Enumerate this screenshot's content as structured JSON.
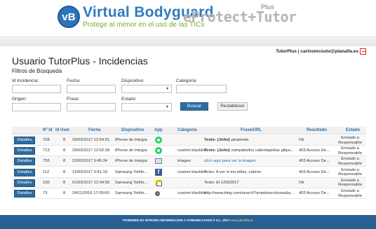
{
  "header": {
    "logo_mark": "vB",
    "brand_name": "Virtual Bodyguard",
    "brand_tagline": "Protege al menor en el uso de las TICs",
    "product_name": "eProtect+Tutor",
    "product_plus": "Plus"
  },
  "user": {
    "info": "TutorPlus | carlosmcouto@planalfa.es"
  },
  "page": {
    "title": "Usuario TutorPlus - Incidencias",
    "filters_title": "Filtros de Búsqueda"
  },
  "filters": {
    "id_label": "Id Incidencia:",
    "fecha_label": "Fecha:",
    "dispositivo_label": "Dispositivo:",
    "categoria_label": "Categoría",
    "origen_label": "Origen:",
    "frase_label": "Frase:",
    "estado_label": "Estado",
    "search_button": "Buscar",
    "reset_button": "Restablecer"
  },
  "table": {
    "headers": [
      "Nº Id",
      "Id User",
      "Fecha",
      "Dispositivo",
      "App",
      "Categoría",
      "Frase/URL",
      "Resultado",
      "Estado"
    ],
    "details_label": "Detalles",
    "rows": [
      {
        "id": "708",
        "user": "8",
        "fecha": "29/03/2017 12:54:01",
        "dispositivo": "iPhone de Integra",
        "app": "whatsapp-icon",
        "categoria": "",
        "frase_bold": "Texto: {John}",
        "frase": "pimpinela",
        "resultado": "Ok",
        "estado1": "Enviado a",
        "estado2": "Responsable"
      },
      {
        "id": "713",
        "user": "8",
        "fecha": "29/03/2017 12:52:28",
        "dispositivo": "iPhone de Integra",
        "app": "whatsapp-icon",
        "categoria": "custom blacklist",
        "frase_bold": "Texto: {John}",
        "frase": "zampabollos calientapollas gilipu...",
        "resultado": "403 Acceso De...",
        "estado1": "Enviado a",
        "estado2": "Responsable"
      },
      {
        "id": "755",
        "user": "8",
        "fecha": "23/03/2017 9:45:34",
        "dispositivo": "iPhone de Integra",
        "app": "image-icon",
        "categoria": "imagen",
        "frase_bold": "",
        "frase": "click aquí para ver la imagen",
        "resultado": "403 Acceso De...",
        "estado1": "Enviado a",
        "estado2": "Responsable"
      },
      {
        "id": "112",
        "user": "8",
        "fecha": "15/03/2017 9:41:19",
        "dispositivo": "Samsung Teléfo...",
        "app": "facebook-icon",
        "categoria": "custom blacklist",
        "frase_bold": "",
        "frase": "Texto: A ver si me pillas, cabron",
        "resultado": "403 Acceso De...",
        "estado1": "Enviado a",
        "estado2": "Responsable"
      },
      {
        "id": "100",
        "user": "8",
        "fecha": "01/03/2017 12:34:50",
        "dispositivo": "Samsung Teléfo...",
        "app": "snapchat-icon",
        "categoria": "",
        "frase_bold": "",
        "frase": "Texto: El 1/03/2017",
        "resultado": "Ok",
        "estado1": "Enviado a",
        "estado2": "Responsable"
      },
      {
        "id": "73",
        "user": "8",
        "fecha": "24/11/2016 17:09:00",
        "dispositivo": "Samsung Teléfo...",
        "app": "chrome-icon",
        "categoria": "custom blacklist",
        "frase_bold": "",
        "frase": "http://www.bing.com/search?q=peleas+duras&q...",
        "resultado": "403 Acceso De...",
        "estado1": "Enviado a",
        "estado2": "Responsable"
      }
    ]
  },
  "footer": {
    "powered_by": "POWERED BY",
    "company": "INTEGRA INFORMACION Y COMUNICACION ® S.L. 2017",
    "site": "www.planalfa.es"
  },
  "colors": {
    "primary": "#2d6ca2",
    "footer": "#2a5f96",
    "brand_blue": "#2f7cc0",
    "brand_green": "#7aaa2a"
  }
}
